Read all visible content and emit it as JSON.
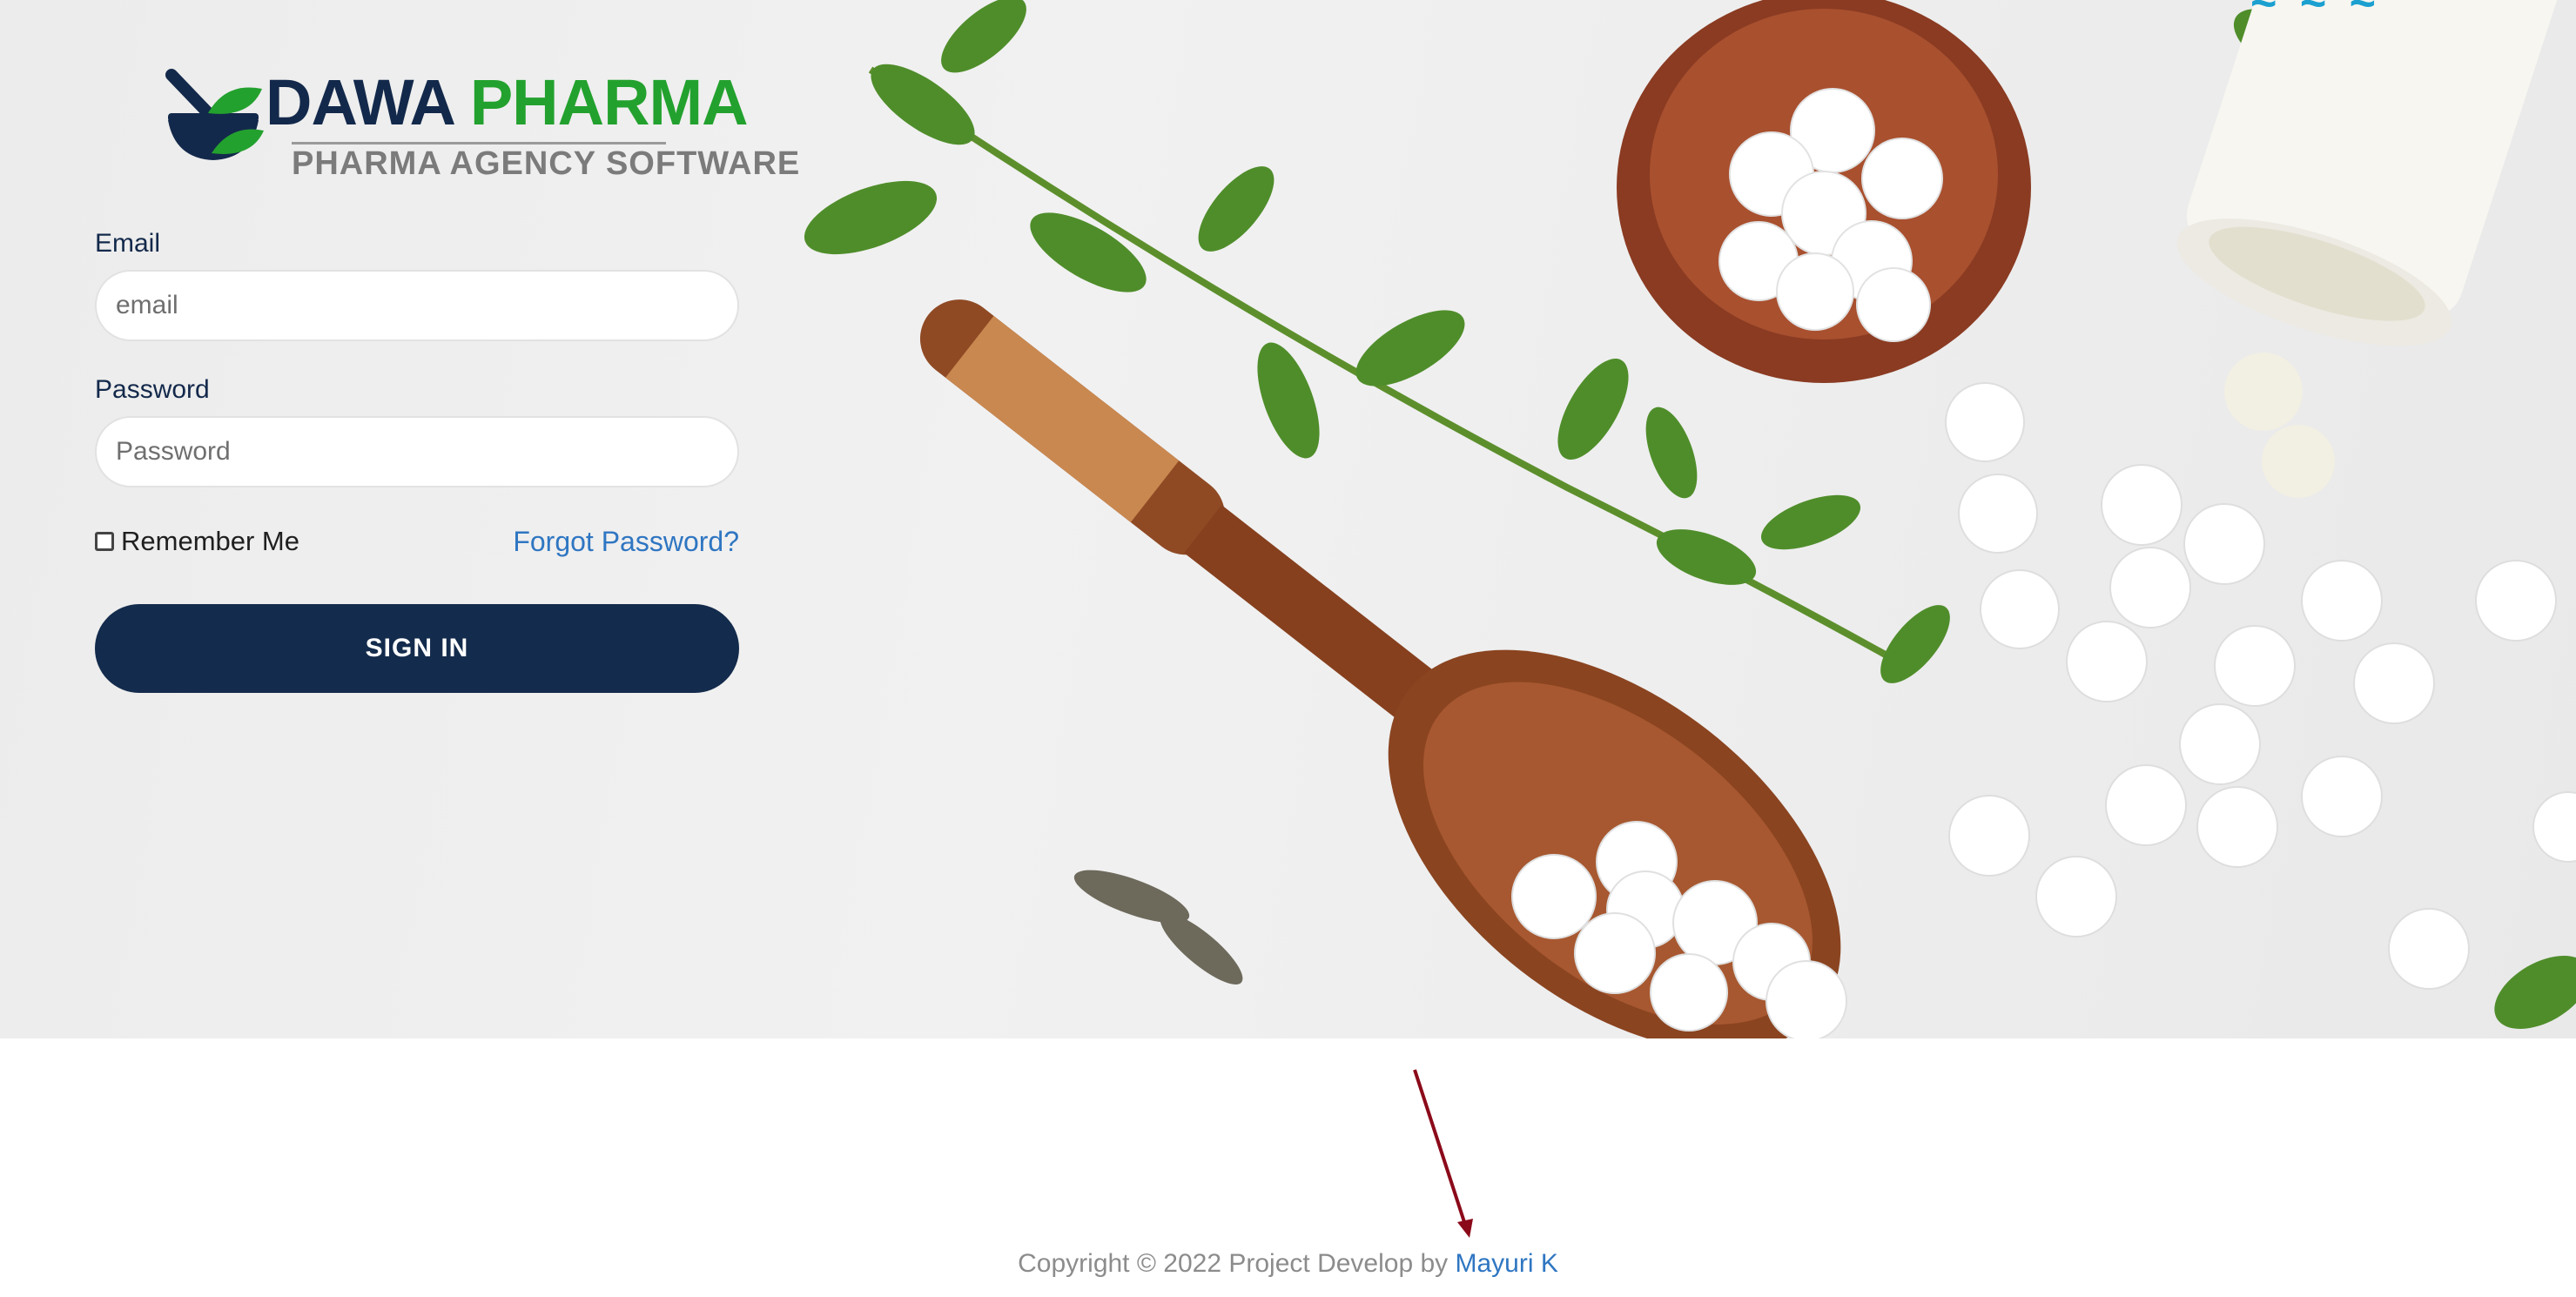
{
  "brand": {
    "name_part1": "DAWA",
    "name_part2": "PHARMA",
    "tagline": "PHARMA AGENCY SOFTWARE",
    "colors": {
      "navy": "#13294b",
      "green": "#23a12e",
      "gray": "#7b7b7b"
    },
    "icon": "mortar-pestle-leaf-icon"
  },
  "login": {
    "email_label": "Email",
    "email_placeholder": "email",
    "email_value": "",
    "password_label": "Password",
    "password_placeholder": "Password",
    "password_value": "",
    "remember_label": "Remember Me",
    "remember_checked": false,
    "forgot_label": "Forgot Password?",
    "signin_label": "SIGN IN"
  },
  "footer": {
    "copyright_text": "Copyright © 2022 Project Develop by ",
    "author": "Mayuri K"
  },
  "colors": {
    "button_bg": "#132b4c",
    "link": "#2f76c2",
    "arrow": "#8b0a1a"
  }
}
